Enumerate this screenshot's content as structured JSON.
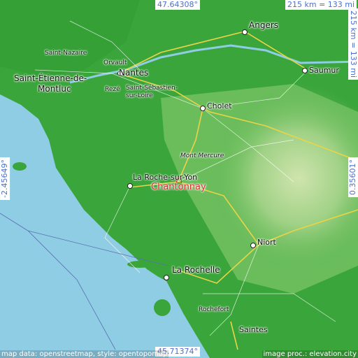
{
  "map": {
    "coords": {
      "north": "47.64308°",
      "south": "45.71374°",
      "west": "-2.45649°",
      "east": "0.35601°"
    },
    "scale": {
      "horizontal": "215 km = 133 mi",
      "vertical": "215 km = 133 mi"
    },
    "target": {
      "name": "Chantonnay"
    },
    "cities": [
      {
        "name": "Angers",
        "type": "big"
      },
      {
        "name": "Saumur",
        "type": "normal"
      },
      {
        "name": "Nantes",
        "type": "big"
      },
      {
        "name": "Saint-Nazaire",
        "type": "small"
      },
      {
        "name": "Orvault",
        "type": "small"
      },
      {
        "name": "Saint-Étienne-de-",
        "type": "big"
      },
      {
        "name": "Montluc",
        "type": "big"
      },
      {
        "name": "Rezé",
        "type": "small"
      },
      {
        "name": "Saint-Sébastien-",
        "type": "small"
      },
      {
        "name": "sur-Loire",
        "type": "small"
      },
      {
        "name": "Cholet",
        "type": "normal"
      },
      {
        "name": "Mont Mercure",
        "type": "ital"
      },
      {
        "name": "La Roche-sur-Yon",
        "type": "normal"
      },
      {
        "name": "Niort",
        "type": "normal"
      },
      {
        "name": "La Rochelle",
        "type": "big"
      },
      {
        "name": "Rochefort",
        "type": "small"
      },
      {
        "name": "Saintes",
        "type": "normal"
      }
    ],
    "credits": {
      "left": "map data: openstreetmap, style: opentopomap",
      "right": "image proc.: elevation.city"
    },
    "colors": {
      "sea": "#8fcde4",
      "lowland": "#3aa53a",
      "midland": "#7cc46a",
      "upland": "#c3dea0",
      "target": "#d83030",
      "coord_text": "#4a6fd1"
    }
  }
}
